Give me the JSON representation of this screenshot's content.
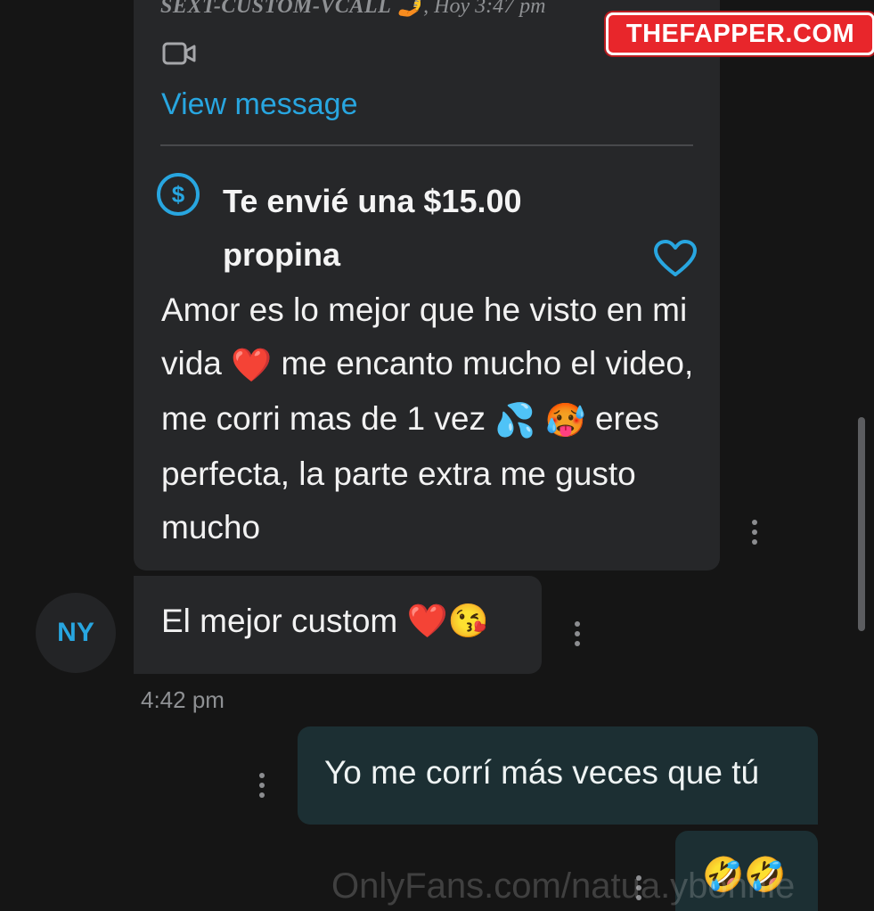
{
  "watermark": {
    "logo_text": "THEFAPPER.COM",
    "bottom_text": "OnlyFans.com/natua.ybonnie"
  },
  "conversation": {
    "incoming_tip_message": {
      "sender": "SEXT-CUSTOM-VCALL",
      "sender_emoji": "🤳",
      "time": ", Hoy 3:47 pm",
      "view_message_label": "View message",
      "tip_text": "Te envié una $15.00 propina",
      "body_parts": [
        "Amor es lo mejor que he visto en mi vida ",
        "❤️",
        " me encanto mucho el video, me corri mas de 1 vez ",
        "💦",
        " ",
        "🥵",
        " eres perfecta, la parte extra me gusto mucho"
      ]
    },
    "avatar_initials": "NY",
    "incoming_message_2": {
      "text": "El mejor custom ",
      "emojis": "❤️😘"
    },
    "timestamp": "4:42 pm",
    "outgoing_message_1": {
      "text": "Yo me corrí más veces que tú"
    },
    "outgoing_message_2": {
      "emojis": "🤣🤣"
    }
  },
  "colors": {
    "accent": "#28a6e0",
    "incoming_bubble": "#262729",
    "outgoing_bubble": "#1c2f33",
    "background": "#151515"
  }
}
